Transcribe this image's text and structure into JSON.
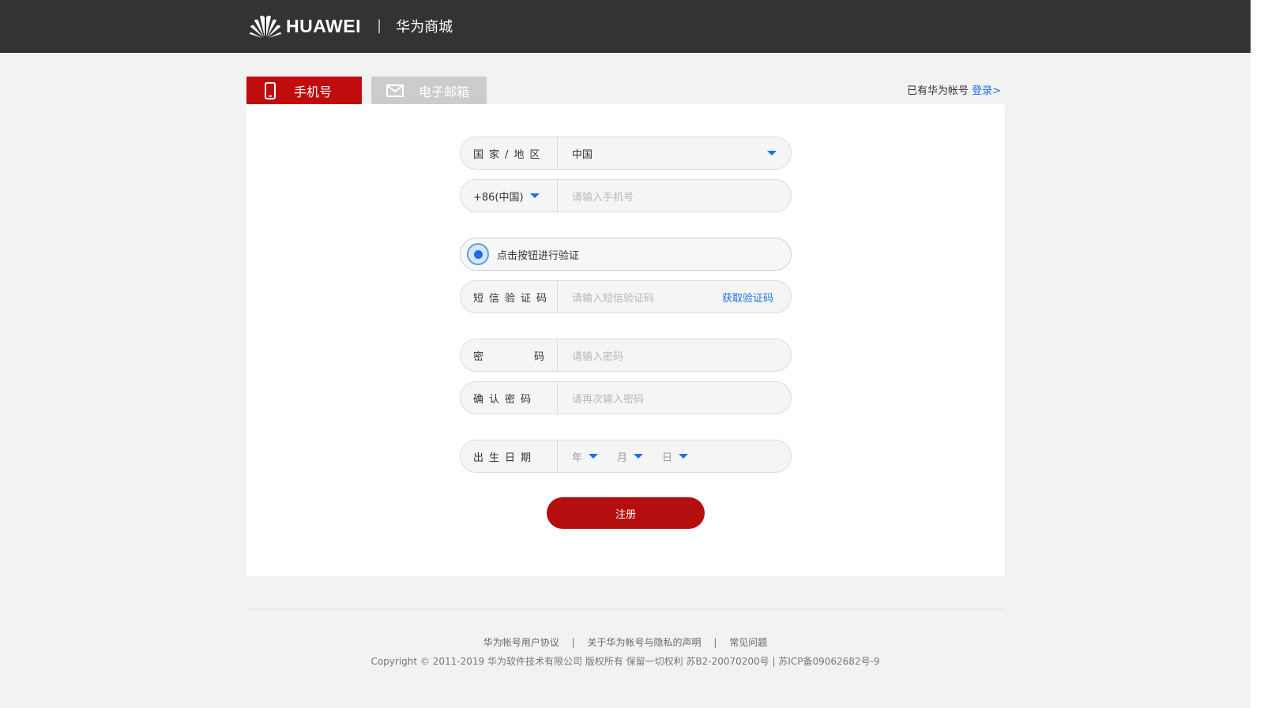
{
  "header": {
    "brand": "HUAWEI",
    "separator": "|",
    "store": "华为商城"
  },
  "tabs": [
    {
      "label": "手机号",
      "icon": "phone-icon",
      "active": true
    },
    {
      "label": "电子邮箱",
      "icon": "mail-icon",
      "active": false
    }
  ],
  "login_prompt": {
    "text": "已有华为帐号",
    "link": "登录>"
  },
  "form": {
    "region": {
      "label": "国家/地区",
      "value": "中国"
    },
    "phone": {
      "code": "+86(中国)",
      "placeholder": "请输入手机号"
    },
    "verify": {
      "text": "点击按钮进行验证"
    },
    "sms": {
      "label": "短信验证码",
      "placeholder": "请输入短信验证码",
      "action": "获取验证码"
    },
    "password": {
      "label_a": "密",
      "label_b": "码",
      "placeholder": "请输入密码"
    },
    "confirm": {
      "label": "确认密码",
      "placeholder": "请再次输入密码"
    },
    "dob": {
      "label": "出生日期",
      "year": "年",
      "month": "月",
      "day": "日"
    },
    "submit": "注册"
  },
  "footer": {
    "links": [
      "华为帐号用户协议",
      "关于华为帐号与隐私的声明",
      "常见问题"
    ],
    "separator": "|",
    "copyright": "Copyright © 2011-2019  华为软件技术有限公司  版权所有  保留一切权利  苏B2-20070200号 | 苏ICP备09062682号-9"
  },
  "colors": {
    "accent": "#c00c0c",
    "link": "#1a6fe8",
    "topbar": "#333333"
  }
}
